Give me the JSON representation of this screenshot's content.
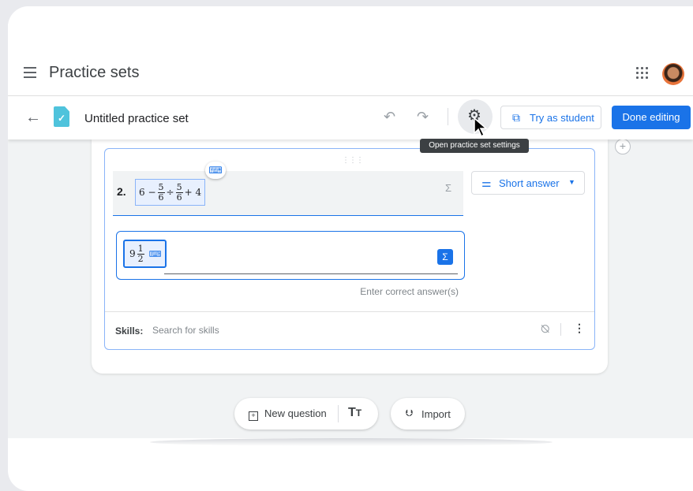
{
  "appbar": {
    "title": "Practice sets",
    "menu_icon": "hamburger-menu-icon",
    "apps_icon": "apps-grid-icon"
  },
  "editor": {
    "doc_title": "Untitled practice set",
    "try_as_student_label": "Try as student",
    "done_editing_label": "Done editing",
    "settings_tooltip": "Open practice set settings",
    "icons": [
      "back-arrow-icon",
      "practice-set-doc-icon",
      "undo-icon",
      "redo-icon",
      "settings-gear-icon",
      "open-in-new-icon"
    ]
  },
  "question": {
    "number": "2.",
    "expression": {
      "lead": "6 −",
      "frac1_num": "5",
      "frac1_den": "6",
      "op": "÷",
      "frac2_num": "5",
      "frac2_den": "6",
      "tail": "+ 4"
    },
    "type_label": "Short answer",
    "answer": {
      "whole": "9",
      "num": "1",
      "den": "2"
    },
    "answer_hint": "Enter correct answer(s)",
    "sigma_symbol": "Σ"
  },
  "skills": {
    "label": "Skills:",
    "placeholder": "Search for skills"
  },
  "bottom": {
    "new_question_label": "New question",
    "text_icon_label": "T",
    "text_icon_small": "T",
    "import_label": "Import"
  },
  "colors": {
    "accent": "#1a73e8",
    "page_bg": "#f1f3f4",
    "doc_icon": "#4fc3dc"
  }
}
